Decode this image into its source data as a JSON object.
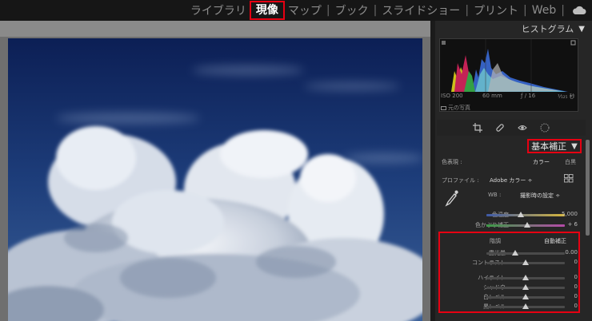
{
  "modules": [
    {
      "label": "ライブラリ",
      "active": false
    },
    {
      "label": "現像",
      "active": true
    },
    {
      "label": "マップ",
      "active": false
    },
    {
      "label": "ブック",
      "active": false
    },
    {
      "label": "スライドショー",
      "active": false
    },
    {
      "label": "プリント",
      "active": false
    },
    {
      "label": "Web",
      "active": false
    }
  ],
  "histogram": {
    "title": "ヒストグラム",
    "iso": "ISO 200",
    "focal": "60 mm",
    "aperture": "ƒ / 16",
    "shutter": "¹⁄₁₂₅ 秒",
    "original_photo": "元の写真"
  },
  "basic": {
    "title": "基本補正",
    "treatment_label": "色表現 :",
    "treatment_color": "カラー",
    "treatment_bw": "白黒",
    "profile_label": "プロファイル :",
    "profile_value": "Adobe カラー ÷",
    "wb_label": "WB :",
    "wb_value": "撮影時の設定 ÷",
    "temp_label": "色温度",
    "temp_value": "5,000",
    "tint_label": "色かぶり補正",
    "tint_value": "+ 6",
    "tone_label": "階調",
    "auto_label": "自動補正",
    "exposure_label": "露光量",
    "exposure_value": "0.00",
    "contrast_label": "コントラスト",
    "contrast_value": "0",
    "highlights_label": "ハイライト",
    "highlights_value": "0",
    "shadows_label": "シャドウ",
    "shadows_value": "0",
    "whites_label": "白レベル",
    "whites_value": "0",
    "blacks_label": "黒レベル",
    "blacks_value": "0"
  },
  "colors": {
    "highlight_box": "#e60012",
    "panel_bg": "#262626",
    "topbar_bg": "#161616"
  },
  "icons": [
    "cloud-icon",
    "crop-icon",
    "heal-icon",
    "redeye-icon",
    "mask-icon",
    "eyedropper-icon",
    "grid-icon"
  ]
}
